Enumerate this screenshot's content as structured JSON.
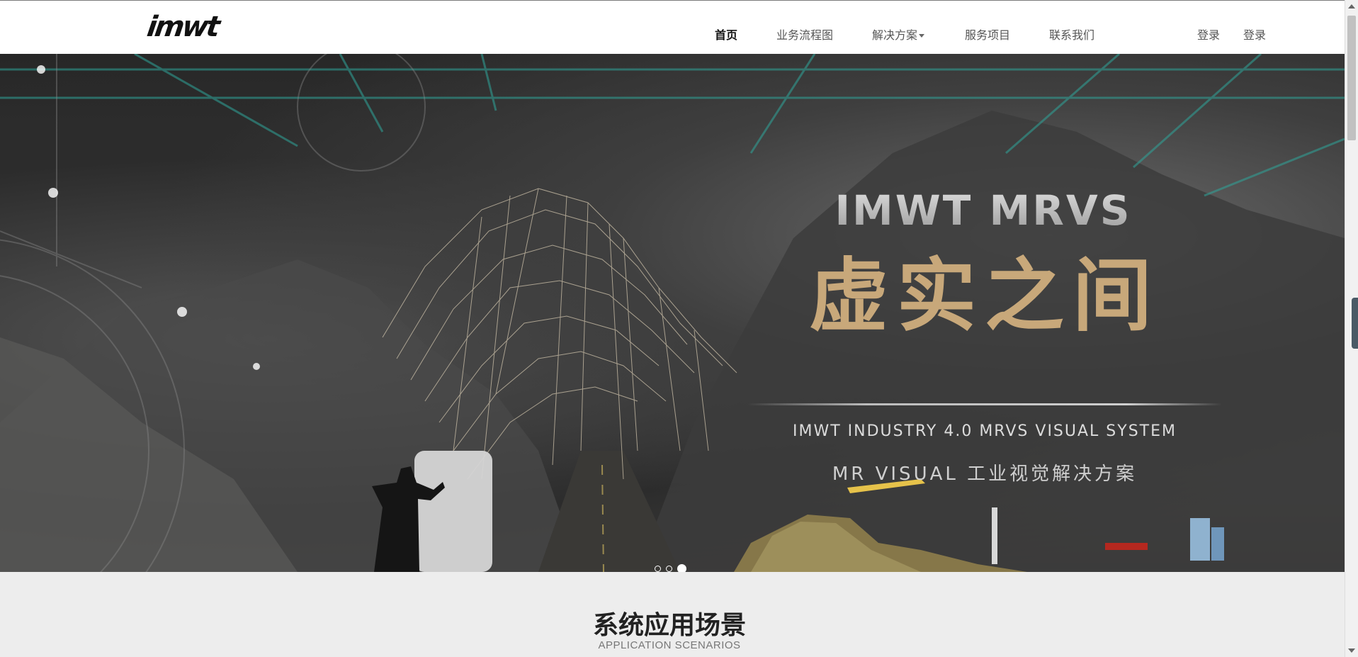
{
  "header": {
    "logo_text": "imwt",
    "nav": [
      {
        "label": "首页",
        "active": true
      },
      {
        "label": "业务流程图",
        "active": false
      },
      {
        "label": "解决方案",
        "active": false,
        "dropdown": true
      },
      {
        "label": "服务项目",
        "active": false
      },
      {
        "label": "联系我们",
        "active": false
      }
    ],
    "auth": [
      {
        "label": "登录"
      },
      {
        "label": "登录"
      }
    ]
  },
  "banner": {
    "brand_title": "IMWT MRVS",
    "cn_title": "虚实之间",
    "subtitle_en": "IMWT INDUSTRY 4.0 MRVS VISUAL SYSTEM",
    "subtitle_cn": "MR VISUAL 工业视觉解决方案",
    "slides": 3,
    "active_slide": 3
  },
  "section": {
    "title": "系统应用场景",
    "subtitle": "APPLICATION SCENARIOS"
  },
  "colors": {
    "gold": "#c8a87a",
    "teal_lines": "#2fa59a",
    "header_bg": "#ffffff",
    "page_bg": "#ededed"
  }
}
